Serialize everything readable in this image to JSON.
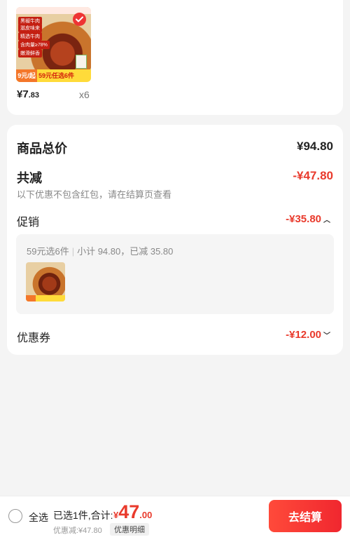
{
  "product": {
    "image_tags": [
      "黑椒牛肉",
      "滋皮味来",
      "精选牛肉",
      "含肉量≥78%",
      "嫩滑鲜香"
    ],
    "promo_badge_left": "9元/起",
    "promo_badge_right": "59元任选6件",
    "price_symbol": "¥",
    "price_int": "7",
    "price_dec": ".83",
    "quantity": "x6",
    "selected": true
  },
  "summary": {
    "total_label": "商品总价",
    "total_value": "¥94.80",
    "reduce_label": "共减",
    "reduce_value": "-¥47.80",
    "reduce_note": "以下优惠不包含红包，请在结算页查看",
    "promo_label": "促销",
    "promo_value": "-¥35.80",
    "promo_box": {
      "deal": "59元选6件",
      "separator": "|",
      "subtotal": "小计 94.80，已减 35.80"
    },
    "coupon_label": "优惠券",
    "coupon_value": "-¥12.00"
  },
  "bottom_bar": {
    "select_all": "全选",
    "selected_text": "已选1件,合计:",
    "total_currency": "¥",
    "total_int": "47",
    "total_dec": ".00",
    "discount_note": "优惠减:¥47.80",
    "detail_label": "优惠明细",
    "checkout_label": "去结算"
  },
  "colors": {
    "accent": "#e93a2c",
    "checkout_gradient_start": "#ff4a3a",
    "checkout_gradient_end": "#f0272f"
  },
  "icons": {
    "selected_check": "check-icon",
    "expand_promo": "chevron-up-icon",
    "expand_coupon": "chevron-down-icon"
  }
}
